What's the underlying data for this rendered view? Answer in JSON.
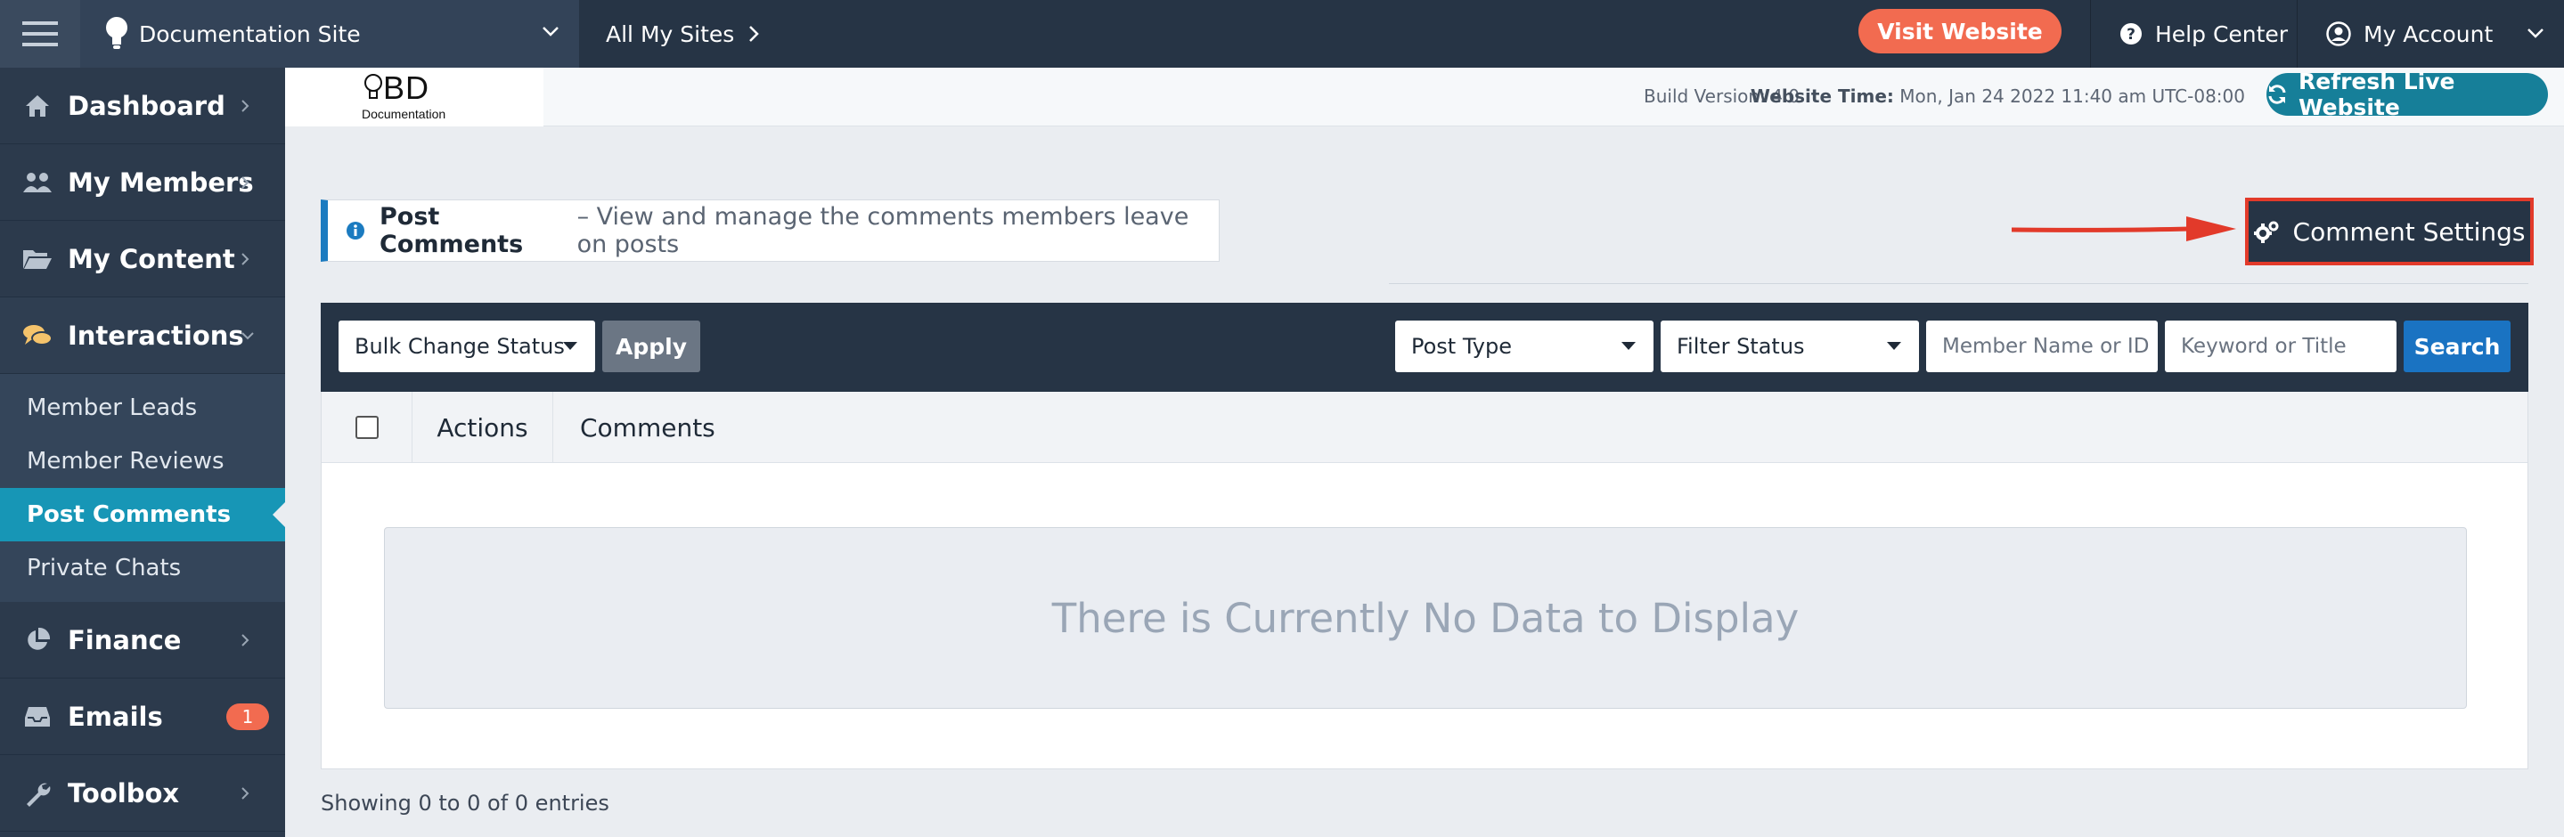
{
  "topbar": {
    "site_name": "Documentation Site",
    "all_sites": "All My Sites",
    "visit_label": "Visit Website",
    "help_label": "Help Center",
    "account_label": "My Account"
  },
  "sidebar": {
    "items": [
      {
        "label": "Dashboard",
        "icon": "home-icon"
      },
      {
        "label": "My Members",
        "icon": "users-icon"
      },
      {
        "label": "My Content",
        "icon": "folder-icon"
      },
      {
        "label": "Interactions",
        "icon": "chat-icon",
        "expanded": true
      },
      {
        "label": "Finance",
        "icon": "pie-chart-icon"
      },
      {
        "label": "Emails",
        "icon": "inbox-icon",
        "badge": "1"
      },
      {
        "label": "Toolbox",
        "icon": "wrench-icon"
      }
    ],
    "subitems": [
      {
        "label": "Member Leads"
      },
      {
        "label": "Member Reviews"
      },
      {
        "label": "Post Comments",
        "selected": true
      },
      {
        "label": "Private Chats"
      }
    ]
  },
  "header": {
    "logo_text": "BD",
    "logo_sub": "Documentation",
    "build": "Build Version: 4.0",
    "time_label": "Website Time:",
    "time_value": "Mon, Jan 24 2022 11:40 am UTC-08:00",
    "refresh_label": "Refresh Live Website"
  },
  "page": {
    "title": "Post Comments",
    "description": "– View and manage the comments members leave on posts",
    "settings_label": "Comment Settings"
  },
  "filters": {
    "bulk_label": "Bulk Change Status",
    "apply_label": "Apply",
    "post_type": "Post Type",
    "filter_status": "Filter Status",
    "member_placeholder": "Member Name or ID",
    "keyword_placeholder": "Keyword or Title",
    "search_label": "Search"
  },
  "table": {
    "col_actions": "Actions",
    "col_comments": "Comments",
    "empty_text": "There is Currently No Data to Display",
    "entries_text": "Showing 0 to 0 of 0 entries"
  },
  "colors": {
    "topbar": "#263445",
    "sidebar": "#2c3a4c",
    "accent_teal": "#1796b6",
    "visit_orange": "#f26b50",
    "highlight_red": "#e23a2a",
    "search_blue": "#1a73c2"
  }
}
